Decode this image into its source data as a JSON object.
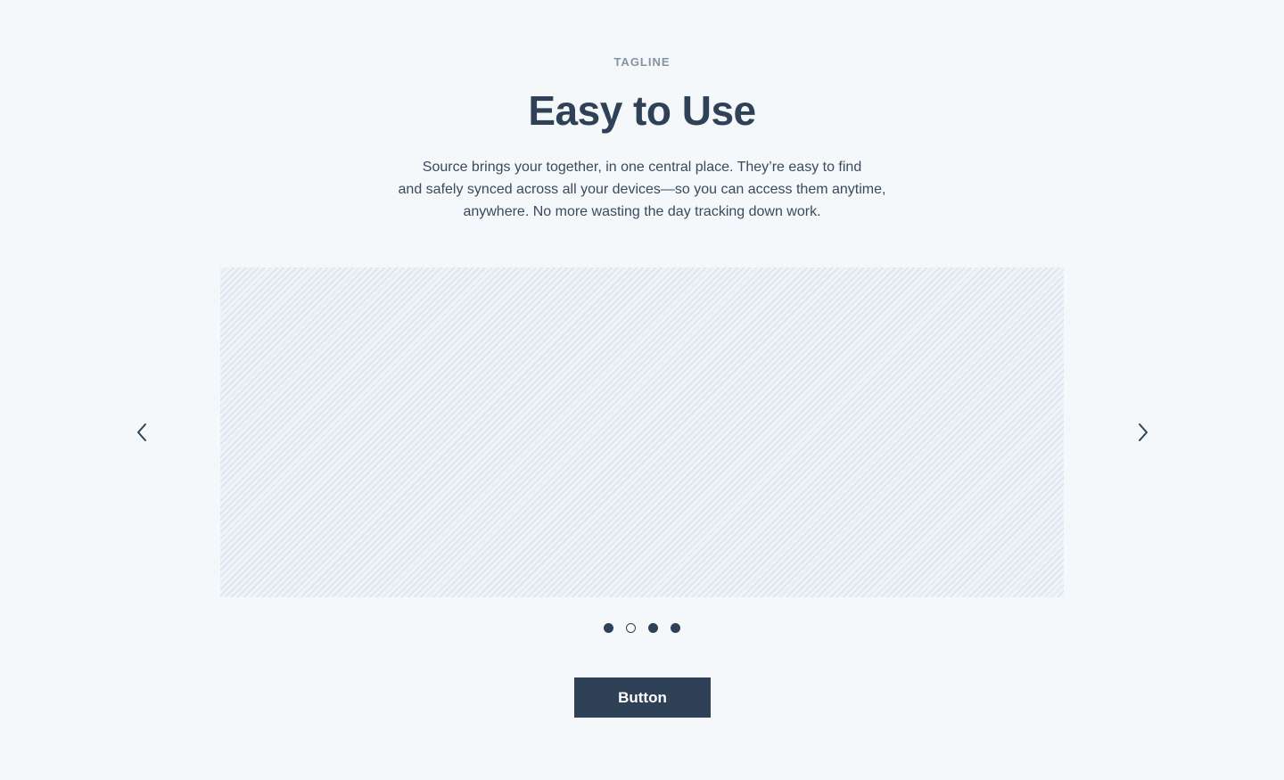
{
  "section": {
    "tagline": "TAGLINE",
    "title": "Easy to Use",
    "description_lines": [
      "Source brings your  together, in one central place. They’re easy to find",
      "and safely synced across all your devices—so you can access them anytime,",
      "anywhere. No more wasting the day tracking down work."
    ]
  },
  "carousel": {
    "prev_icon": "chevron-left-icon",
    "next_icon": "chevron-right-icon",
    "slide_count": 4,
    "active_indicator": 1,
    "indicators": [
      "filled",
      "outline",
      "filled",
      "filled"
    ]
  },
  "cta": {
    "label": "Button"
  },
  "colors": {
    "background": "#f4f8fb",
    "primary": "#2f4156",
    "tagline": "#8393a3",
    "placeholder_stripe": "#cddae6"
  }
}
